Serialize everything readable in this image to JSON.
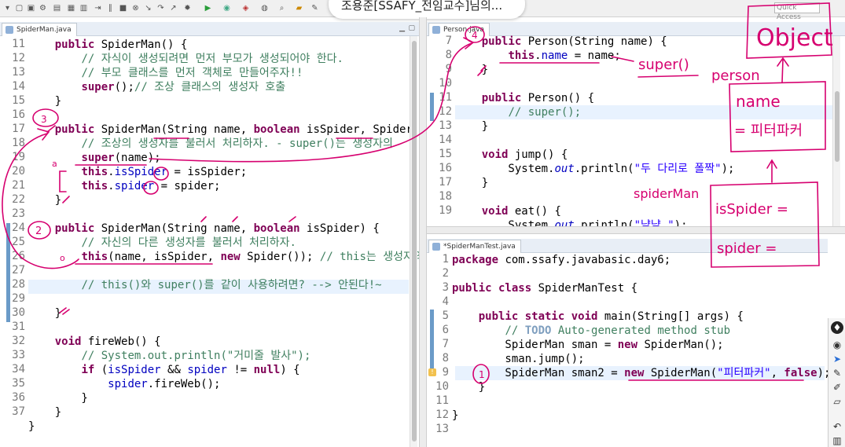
{
  "window": {
    "title_overlay": "조용준[SSAFY_전임교수]님의...",
    "quick_access": "Quick Access"
  },
  "left_editor": {
    "tab": "SpiderMan.java",
    "line_numbers": [
      "11",
      "12",
      "13",
      "14",
      "15",
      "16",
      "17",
      "18",
      "19",
      "20",
      "21",
      "22",
      "23",
      "24",
      "25",
      "26",
      "27",
      "28",
      "29",
      "30",
      "31",
      "32",
      "33",
      "34",
      "35",
      "36",
      "37"
    ]
  },
  "person_editor": {
    "tab": "Person.java",
    "line_numbers": [
      "7",
      "8",
      "9",
      "10",
      "11",
      "12",
      "13",
      "14",
      "15",
      "16",
      "17",
      "18",
      "19"
    ]
  },
  "test_editor": {
    "tab": "*SpiderManTest.java",
    "line_numbers": [
      "1",
      "2",
      "3",
      "4",
      "5",
      "6",
      "7",
      "8",
      "9",
      "10",
      "11",
      "12",
      "13"
    ]
  },
  "annotations": {
    "object": "Object",
    "super_call": "super()",
    "person": "person",
    "name_field": "name",
    "value": "= 피터파커",
    "spiderman": "spiderMan",
    "is_spider": "isSpider =",
    "spider": "spider =",
    "num3": "3",
    "num2": "2",
    "num1": "1",
    "num4": "4",
    "a_mark": "a",
    "o_mark": "o"
  },
  "colors": {
    "keyword": "#7f0055",
    "comment": "#3f7f5f",
    "string": "#2a00ff",
    "field": "#0000c0",
    "ink": "#d6006f"
  }
}
